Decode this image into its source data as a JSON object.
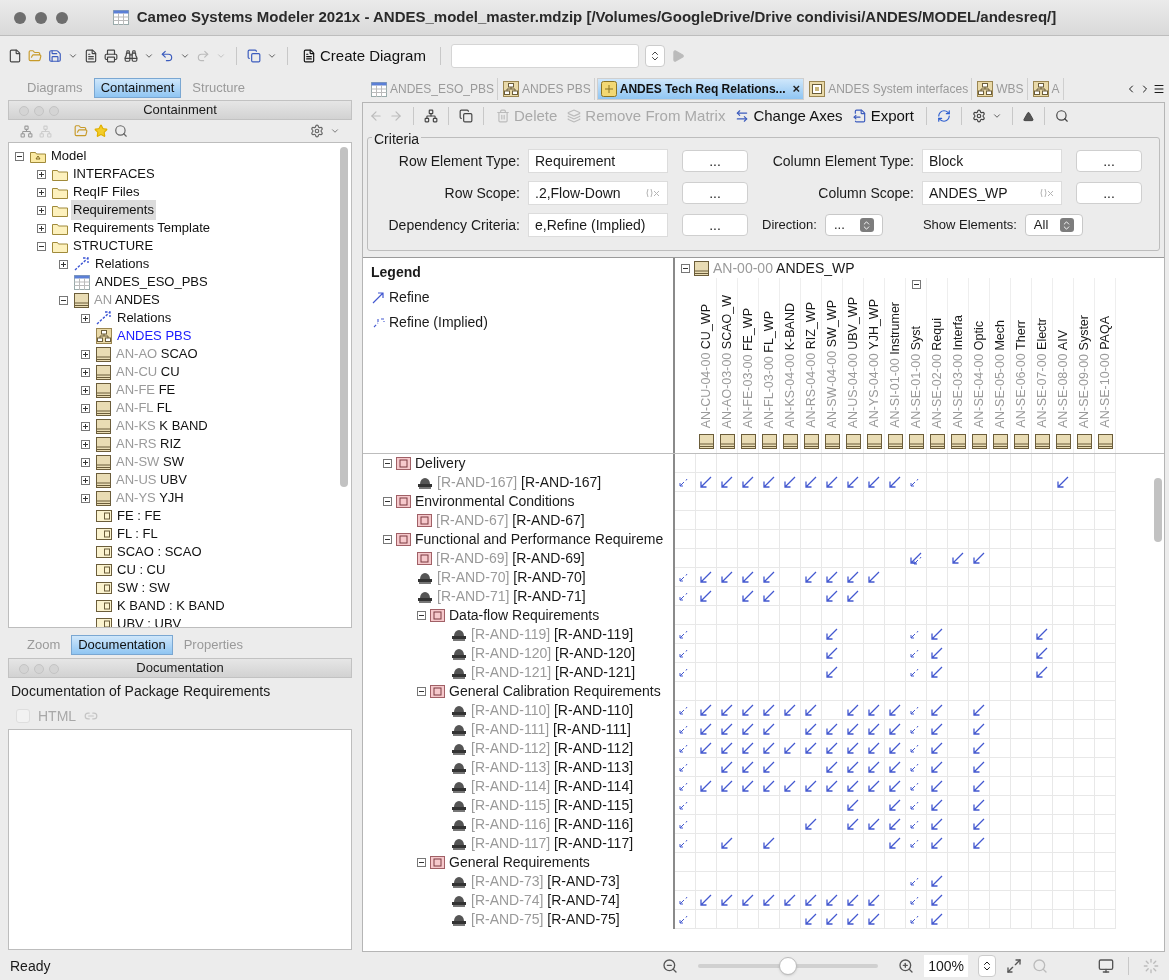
{
  "window": {
    "title": "Cameo Systems Modeler 2021x - ANDES_model_master.mdzip [/Volumes/GoogleDrive/Drive condivisi/ANDES/MODEL/andesreq/]"
  },
  "toolbar": {
    "create_diagram": "Create Diagram"
  },
  "left_tabs": [
    {
      "label": "Diagrams",
      "selected": false
    },
    {
      "label": "Containment",
      "selected": true
    },
    {
      "label": "Structure",
      "selected": false
    }
  ],
  "containment": {
    "title": "Containment",
    "tree": [
      {
        "label": "Model",
        "kind": "model",
        "expanded": true,
        "selected": false,
        "open": false,
        "children": [
          {
            "label": "INTERFACES",
            "kind": "folder",
            "expanded": false,
            "selected": false,
            "open": false
          },
          {
            "label": "ReqIF Files",
            "kind": "folder",
            "expanded": false,
            "selected": false,
            "open": false
          },
          {
            "label": "Requirements",
            "kind": "folder",
            "expanded": false,
            "selected": true,
            "open": false
          },
          {
            "label": "Requirements Template",
            "kind": "folder",
            "expanded": false,
            "selected": false,
            "open": false
          },
          {
            "label": "STRUCTURE",
            "kind": "folder",
            "expanded": true,
            "selected": false,
            "open": false,
            "children": [
              {
                "label": "Relations",
                "kind": "relations",
                "expanded": false,
                "selected": false,
                "open": false
              },
              {
                "label": "ANDES_ESO_PBS",
                "kind": "table",
                "selected": false,
                "open": false
              },
              {
                "prefix": "AN",
                "label": "ANDES",
                "kind": "block",
                "expanded": true,
                "selected": false,
                "open": false,
                "children": [
                  {
                    "label": "Relations",
                    "kind": "relations",
                    "expanded": false,
                    "selected": false,
                    "open": false
                  },
                  {
                    "label": "ANDES PBS",
                    "kind": "diagram",
                    "selected": false,
                    "open": true
                  },
                  {
                    "prefix": "AN-AO",
                    "label": "SCAO",
                    "kind": "block",
                    "expanded": false,
                    "selected": false,
                    "open": false
                  },
                  {
                    "prefix": "AN-CU",
                    "label": "CU",
                    "kind": "block",
                    "expanded": false,
                    "selected": false,
                    "open": false
                  },
                  {
                    "prefix": "AN-FE",
                    "label": "FE",
                    "kind": "block",
                    "expanded": false,
                    "selected": false,
                    "open": false
                  },
                  {
                    "prefix": "AN-FL",
                    "label": "FL",
                    "kind": "block",
                    "expanded": false,
                    "selected": false,
                    "open": false
                  },
                  {
                    "prefix": "AN-KS",
                    "label": "K BAND",
                    "kind": "block",
                    "expanded": false,
                    "selected": false,
                    "open": false
                  },
                  {
                    "prefix": "AN-RS",
                    "label": "RIZ",
                    "kind": "block",
                    "expanded": false,
                    "selected": false,
                    "open": false
                  },
                  {
                    "prefix": "AN-SW",
                    "label": "SW",
                    "kind": "block",
                    "expanded": false,
                    "selected": false,
                    "open": false
                  },
                  {
                    "prefix": "AN-US",
                    "label": "UBV",
                    "kind": "block",
                    "expanded": false,
                    "selected": false,
                    "open": false
                  },
                  {
                    "prefix": "AN-YS",
                    "label": "YJH",
                    "kind": "block",
                    "expanded": false,
                    "selected": false,
                    "open": false
                  },
                  {
                    "label": "FE : FE",
                    "kind": "part",
                    "selected": false,
                    "open": false
                  },
                  {
                    "label": "FL : FL",
                    "kind": "part",
                    "selected": false,
                    "open": false
                  },
                  {
                    "label": "SCAO : SCAO",
                    "kind": "part",
                    "selected": false,
                    "open": false
                  },
                  {
                    "label": "CU : CU",
                    "kind": "part",
                    "selected": false,
                    "open": false
                  },
                  {
                    "label": "SW : SW",
                    "kind": "part",
                    "selected": false,
                    "open": false
                  },
                  {
                    "label": "K BAND : K BAND",
                    "kind": "part",
                    "selected": false,
                    "open": false
                  },
                  {
                    "label": "UBV : UBV",
                    "kind": "part",
                    "selected": false,
                    "open": false
                  }
                ]
              }
            ]
          }
        ]
      }
    ]
  },
  "bottom_tabs": [
    {
      "label": "Zoom",
      "selected": false
    },
    {
      "label": "Documentation",
      "selected": true
    },
    {
      "label": "Properties",
      "selected": false
    }
  ],
  "documentation": {
    "title": "Documentation",
    "heading": "Documentation of Package Requirements",
    "html_label": "HTML",
    "html_checked": false
  },
  "editor_tabs": [
    {
      "label": "ANDES_ESO_PBS",
      "kind": "table",
      "selected": false
    },
    {
      "label": "ANDES PBS",
      "kind": "diagram",
      "selected": false
    },
    {
      "label": "ANDES Tech Req Relations...",
      "kind": "matrix",
      "selected": true,
      "close": "×"
    },
    {
      "label": "ANDES System interfaces",
      "kind": "ibd",
      "selected": false
    },
    {
      "label": "WBS",
      "kind": "diagram",
      "selected": false
    },
    {
      "label": "A",
      "kind": "diagram",
      "selected": false
    }
  ],
  "matrix_toolbar": [
    {
      "label": "Delete",
      "kind": "delete",
      "disabled": true
    },
    {
      "label": "Remove From Matrix",
      "kind": "remove",
      "disabled": true
    },
    {
      "label": "Change Axes",
      "kind": "axes",
      "disabled": false
    },
    {
      "label": "Export",
      "kind": "export",
      "disabled": false
    }
  ],
  "criteria": {
    "title": "Criteria",
    "rows": [
      [
        {
          "label": "Row Element Type:",
          "value": "Requirement",
          "kind": "text",
          "button": "..."
        },
        {
          "label": "Column Element Type:",
          "value": "Block",
          "kind": "text",
          "button": "..."
        }
      ],
      [
        {
          "label": "Row Scope:",
          "value": ".2,Flow-Down",
          "kind": "expression",
          "button": "..."
        },
        {
          "label": "Column Scope:",
          "value": "ANDES_WP",
          "kind": "expression",
          "button": "..."
        }
      ],
      [
        {
          "label": "Dependency Criteria:",
          "value": "e,Refine (Implied)",
          "kind": "text",
          "button": "..."
        },
        {
          "label": "Direction:",
          "value": "...",
          "kind": "select"
        },
        {
          "label": "Show Elements:",
          "value": "All",
          "kind": "select"
        }
      ]
    ]
  },
  "legend": {
    "title": "Legend",
    "items": [
      {
        "label": "Refine",
        "kind": "refine"
      },
      {
        "label": "Refine (Implied)",
        "kind": "implied"
      }
    ]
  },
  "matrix": {
    "column_group": {
      "id": "AN-00-00",
      "name": "ANDES_WP",
      "expanded": true
    },
    "columns": [
      {
        "id": "AN-CU-04-00",
        "name": "CU_WP",
        "kind": "element"
      },
      {
        "id": "AN-AO-03-00",
        "name": "SCAO_W",
        "kind": "element"
      },
      {
        "id": "AN-FE-03-00",
        "name": "FE_WP",
        "kind": "element"
      },
      {
        "id": "AN-FL-03-00",
        "name": "FL_WP",
        "kind": "element"
      },
      {
        "id": "AN-KS-04-00",
        "name": "K-BAND",
        "kind": "element"
      },
      {
        "id": "AN-RS-04-00",
        "name": "RIZ_WP",
        "kind": "element"
      },
      {
        "id": "AN-SW-04-00",
        "name": "SW_WP",
        "kind": "element"
      },
      {
        "id": "AN-US-04-00",
        "name": "UBV_WP",
        "kind": "element"
      },
      {
        "id": "AN-YS-04-00",
        "name": "YJH_WP",
        "kind": "element"
      },
      {
        "id": "AN-SI-01-00",
        "name": "Instrumer",
        "kind": "element"
      },
      {
        "id": "AN-SE-01-00",
        "name": "Syst",
        "kind": "group"
      },
      {
        "id": "AN-SE-02-00",
        "name": "Requi",
        "kind": "element"
      },
      {
        "id": "AN-SE-03-00",
        "name": "Interfa",
        "kind": "element"
      },
      {
        "id": "AN-SE-04-00",
        "name": "Optic",
        "kind": "element"
      },
      {
        "id": "AN-SE-05-00",
        "name": "Mech",
        "kind": "element"
      },
      {
        "id": "AN-SE-06-00",
        "name": "Therr",
        "kind": "element"
      },
      {
        "id": "AN-SE-07-00",
        "name": "Electr",
        "kind": "element"
      },
      {
        "id": "AN-SE-08-00",
        "name": "AIV",
        "kind": "element"
      },
      {
        "id": "AN-SE-09-00",
        "name": "Syster",
        "kind": "element"
      },
      {
        "id": "AN-SE-10-00",
        "name": "PAQA",
        "kind": "element"
      }
    ],
    "rows": [
      {
        "kind": "group",
        "name": "Delivery",
        "expanded": true,
        "children": [
          {
            "kind": "extended",
            "id": "[R-AND-167]",
            "name": "[R-AND-167]",
            "refine": [
              false,
              true,
              true,
              true,
              true,
              true,
              true,
              true,
              true,
              true,
              true,
              false,
              false,
              false,
              false,
              false,
              false,
              false,
              true,
              false,
              false
            ],
            "implied": [
              true,
              false,
              false,
              false,
              false,
              false,
              false,
              false,
              false,
              false,
              false,
              true,
              false,
              false,
              false,
              false,
              false,
              false,
              false,
              false,
              false
            ]
          }
        ]
      },
      {
        "kind": "group",
        "name": "Environmental Conditions",
        "expanded": true,
        "children": [
          {
            "kind": "requirement",
            "id": "[R-AND-67]",
            "name": "[R-AND-67]",
            "refine": [
              false,
              false,
              false,
              false,
              false,
              false,
              false,
              false,
              false,
              false,
              false,
              false,
              false,
              false,
              false,
              false,
              false,
              false,
              false,
              false,
              false
            ],
            "implied": [
              false,
              false,
              false,
              false,
              false,
              false,
              false,
              false,
              false,
              false,
              false,
              false,
              false,
              false,
              false,
              false,
              false,
              false,
              false,
              false,
              false
            ]
          }
        ]
      },
      {
        "kind": "group",
        "name": "Functional and Performance Requireme",
        "expanded": true,
        "children": [
          {
            "kind": "requirement",
            "id": "[R-AND-69]",
            "name": "[R-AND-69]",
            "refine": [
              false,
              false,
              false,
              false,
              false,
              false,
              false,
              false,
              false,
              false,
              false,
              true,
              false,
              true,
              true,
              false,
              false,
              false,
              false,
              false,
              false
            ],
            "implied": [
              false,
              false,
              false,
              false,
              false,
              false,
              false,
              false,
              false,
              false,
              false,
              true,
              false,
              false,
              false,
              false,
              false,
              false,
              false,
              false,
              false
            ]
          },
          {
            "kind": "extended",
            "id": "[R-AND-70]",
            "name": "[R-AND-70]",
            "refine": [
              false,
              true,
              true,
              true,
              true,
              false,
              true,
              true,
              true,
              true,
              false,
              false,
              false,
              false,
              false,
              false,
              false,
              false,
              false,
              false,
              false
            ],
            "implied": [
              true,
              false,
              false,
              false,
              false,
              false,
              false,
              false,
              false,
              false,
              false,
              false,
              false,
              false,
              false,
              false,
              false,
              false,
              false,
              false,
              false
            ]
          },
          {
            "kind": "extended",
            "id": "[R-AND-71]",
            "name": "[R-AND-71]",
            "refine": [
              false,
              true,
              false,
              true,
              true,
              false,
              false,
              true,
              true,
              false,
              false,
              false,
              false,
              false,
              false,
              false,
              false,
              false,
              false,
              false,
              false
            ],
            "implied": [
              true,
              false,
              false,
              false,
              false,
              false,
              false,
              false,
              false,
              false,
              false,
              false,
              false,
              false,
              false,
              false,
              false,
              false,
              false,
              false,
              false
            ]
          },
          {
            "kind": "group",
            "name": "Data-flow Requirements",
            "expanded": true,
            "children": [
              {
                "kind": "extended",
                "id": "[R-AND-119]",
                "name": "[R-AND-119]",
                "refine": [
                  false,
                  false,
                  false,
                  false,
                  false,
                  false,
                  false,
                  true,
                  false,
                  false,
                  false,
                  false,
                  true,
                  false,
                  false,
                  false,
                  false,
                  true,
                  false,
                  false,
                  false
                ],
                "implied": [
                  true,
                  false,
                  false,
                  false,
                  false,
                  false,
                  false,
                  false,
                  false,
                  false,
                  false,
                  true,
                  false,
                  false,
                  false,
                  false,
                  false,
                  false,
                  false,
                  false,
                  false
                ]
              },
              {
                "kind": "extended",
                "id": "[R-AND-120]",
                "name": "[R-AND-120]",
                "refine": [
                  false,
                  false,
                  false,
                  false,
                  false,
                  false,
                  false,
                  true,
                  false,
                  false,
                  false,
                  false,
                  true,
                  false,
                  false,
                  false,
                  false,
                  true,
                  false,
                  false,
                  false
                ],
                "implied": [
                  true,
                  false,
                  false,
                  false,
                  false,
                  false,
                  false,
                  false,
                  false,
                  false,
                  false,
                  true,
                  false,
                  false,
                  false,
                  false,
                  false,
                  false,
                  false,
                  false,
                  false
                ]
              },
              {
                "kind": "extended",
                "id": "[R-AND-121]",
                "name": "[R-AND-121]",
                "refine": [
                  false,
                  false,
                  false,
                  false,
                  false,
                  false,
                  false,
                  true,
                  false,
                  false,
                  false,
                  false,
                  true,
                  false,
                  false,
                  false,
                  false,
                  true,
                  false,
                  false,
                  false
                ],
                "implied": [
                  true,
                  false,
                  false,
                  false,
                  false,
                  false,
                  false,
                  false,
                  false,
                  false,
                  false,
                  true,
                  false,
                  false,
                  false,
                  false,
                  false,
                  false,
                  false,
                  false,
                  false
                ]
              }
            ]
          },
          {
            "kind": "group",
            "name": "General Calibration Requirements",
            "expanded": true,
            "children": [
              {
                "kind": "extended",
                "id": "[R-AND-110]",
                "name": "[R-AND-110]",
                "refine": [
                  false,
                  true,
                  true,
                  true,
                  true,
                  true,
                  true,
                  false,
                  true,
                  true,
                  true,
                  false,
                  true,
                  false,
                  true,
                  false,
                  false,
                  false,
                  false,
                  false,
                  false
                ],
                "implied": [
                  true,
                  false,
                  false,
                  false,
                  false,
                  false,
                  false,
                  false,
                  false,
                  false,
                  false,
                  true,
                  false,
                  false,
                  false,
                  false,
                  false,
                  false,
                  false,
                  false,
                  false
                ]
              },
              {
                "kind": "extended",
                "id": "[R-AND-111]",
                "name": "[R-AND-111]",
                "refine": [
                  false,
                  true,
                  true,
                  true,
                  true,
                  false,
                  true,
                  true,
                  true,
                  true,
                  true,
                  false,
                  true,
                  false,
                  true,
                  false,
                  false,
                  false,
                  false,
                  false,
                  false
                ],
                "implied": [
                  true,
                  false,
                  false,
                  false,
                  false,
                  false,
                  false,
                  false,
                  false,
                  false,
                  false,
                  true,
                  false,
                  false,
                  false,
                  false,
                  false,
                  false,
                  false,
                  false,
                  false
                ]
              },
              {
                "kind": "extended",
                "id": "[R-AND-112]",
                "name": "[R-AND-112]",
                "refine": [
                  false,
                  true,
                  true,
                  true,
                  true,
                  true,
                  true,
                  true,
                  true,
                  true,
                  true,
                  false,
                  true,
                  false,
                  true,
                  false,
                  false,
                  false,
                  false,
                  false,
                  false
                ],
                "implied": [
                  true,
                  false,
                  false,
                  false,
                  false,
                  false,
                  false,
                  false,
                  false,
                  false,
                  false,
                  true,
                  false,
                  false,
                  false,
                  false,
                  false,
                  false,
                  false,
                  false,
                  false
                ]
              },
              {
                "kind": "extended",
                "id": "[R-AND-113]",
                "name": "[R-AND-113]",
                "refine": [
                  false,
                  false,
                  true,
                  true,
                  true,
                  false,
                  false,
                  true,
                  true,
                  true,
                  true,
                  false,
                  true,
                  false,
                  true,
                  false,
                  false,
                  false,
                  false,
                  false,
                  false
                ],
                "implied": [
                  true,
                  false,
                  false,
                  false,
                  false,
                  false,
                  false,
                  false,
                  false,
                  false,
                  false,
                  true,
                  false,
                  false,
                  false,
                  false,
                  false,
                  false,
                  false,
                  false,
                  false
                ]
              },
              {
                "kind": "extended",
                "id": "[R-AND-114]",
                "name": "[R-AND-114]",
                "refine": [
                  false,
                  true,
                  true,
                  true,
                  true,
                  true,
                  true,
                  true,
                  true,
                  true,
                  true,
                  false,
                  true,
                  false,
                  true,
                  false,
                  false,
                  false,
                  false,
                  false,
                  false
                ],
                "implied": [
                  true,
                  false,
                  false,
                  false,
                  false,
                  false,
                  false,
                  false,
                  false,
                  false,
                  false,
                  true,
                  false,
                  false,
                  false,
                  false,
                  false,
                  false,
                  false,
                  false,
                  false
                ]
              },
              {
                "kind": "extended",
                "id": "[R-AND-115]",
                "name": "[R-AND-115]",
                "refine": [
                  false,
                  false,
                  false,
                  false,
                  false,
                  false,
                  false,
                  false,
                  true,
                  false,
                  true,
                  false,
                  true,
                  false,
                  true,
                  false,
                  false,
                  false,
                  false,
                  false,
                  false
                ],
                "implied": [
                  true,
                  false,
                  false,
                  false,
                  false,
                  false,
                  false,
                  false,
                  false,
                  false,
                  false,
                  true,
                  false,
                  false,
                  false,
                  false,
                  false,
                  false,
                  false,
                  false,
                  false
                ]
              },
              {
                "kind": "extended",
                "id": "[R-AND-116]",
                "name": "[R-AND-116]",
                "refine": [
                  false,
                  false,
                  false,
                  false,
                  false,
                  false,
                  true,
                  false,
                  true,
                  true,
                  true,
                  false,
                  true,
                  false,
                  true,
                  false,
                  false,
                  false,
                  false,
                  false,
                  false
                ],
                "implied": [
                  true,
                  false,
                  false,
                  false,
                  false,
                  false,
                  false,
                  false,
                  false,
                  false,
                  false,
                  true,
                  false,
                  false,
                  false,
                  false,
                  false,
                  false,
                  false,
                  false,
                  false
                ]
              },
              {
                "kind": "extended",
                "id": "[R-AND-117]",
                "name": "[R-AND-117]",
                "refine": [
                  false,
                  false,
                  true,
                  false,
                  true,
                  false,
                  false,
                  false,
                  false,
                  false,
                  true,
                  false,
                  true,
                  false,
                  true,
                  false,
                  false,
                  false,
                  false,
                  false,
                  false
                ],
                "implied": [
                  true,
                  false,
                  false,
                  false,
                  false,
                  false,
                  false,
                  false,
                  false,
                  false,
                  false,
                  true,
                  false,
                  false,
                  false,
                  false,
                  false,
                  false,
                  false,
                  false,
                  false
                ]
              }
            ]
          },
          {
            "kind": "group",
            "name": "General Requirements",
            "expanded": true,
            "children": [
              {
                "kind": "extended",
                "id": "[R-AND-73]",
                "name": "[R-AND-73]",
                "refine": [
                  false,
                  false,
                  false,
                  false,
                  false,
                  false,
                  false,
                  false,
                  false,
                  false,
                  false,
                  false,
                  true,
                  false,
                  false,
                  false,
                  false,
                  false,
                  false,
                  false,
                  false
                ],
                "implied": [
                  false,
                  false,
                  false,
                  false,
                  false,
                  false,
                  false,
                  false,
                  false,
                  false,
                  false,
                  true,
                  false,
                  false,
                  false,
                  false,
                  false,
                  false,
                  false,
                  false,
                  false
                ]
              },
              {
                "kind": "extended",
                "id": "[R-AND-74]",
                "name": "[R-AND-74]",
                "refine": [
                  false,
                  true,
                  true,
                  true,
                  true,
                  true,
                  true,
                  true,
                  true,
                  true,
                  false,
                  false,
                  true,
                  false,
                  false,
                  false,
                  false,
                  false,
                  false,
                  false,
                  false
                ],
                "implied": [
                  true,
                  false,
                  false,
                  false,
                  false,
                  false,
                  false,
                  false,
                  false,
                  false,
                  false,
                  true,
                  false,
                  false,
                  false,
                  false,
                  false,
                  false,
                  false,
                  false,
                  false
                ]
              },
              {
                "kind": "extended",
                "id": "[R-AND-75]",
                "name": "[R-AND-75]",
                "refine": [
                  false,
                  false,
                  false,
                  false,
                  false,
                  false,
                  true,
                  true,
                  true,
                  true,
                  false,
                  false,
                  true,
                  false,
                  false,
                  false,
                  false,
                  false,
                  false,
                  false,
                  false
                ],
                "implied": [
                  true,
                  false,
                  false,
                  false,
                  false,
                  false,
                  false,
                  false,
                  false,
                  false,
                  false,
                  true,
                  false,
                  false,
                  false,
                  false,
                  false,
                  false,
                  false,
                  false,
                  false
                ]
              }
            ]
          }
        ]
      }
    ]
  },
  "status_bar": {
    "text": "Ready",
    "zoom": "100%",
    "level": 0.5
  }
}
